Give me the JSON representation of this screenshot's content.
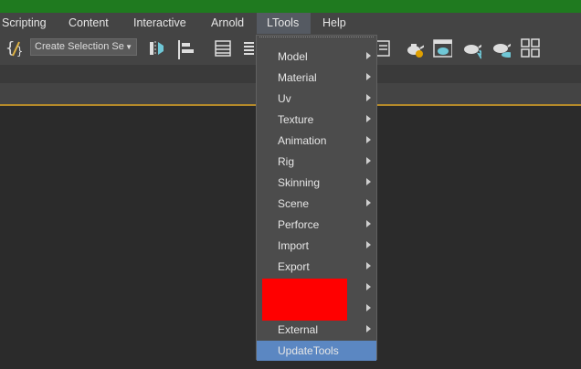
{
  "menubar": {
    "items": [
      "Scripting",
      "Content",
      "Interactive",
      "Arnold",
      "LTools",
      "Help"
    ]
  },
  "toolbar": {
    "selection_set_value": "Create Selection Se",
    "icons": [
      "script-brace-icon",
      "selection-set-combo",
      "mirror-icon",
      "align-icon",
      "layer-list-icon",
      "scene-explorer-icon",
      "render-setup-icon",
      "render-frame-icon",
      "render-teapot-icon",
      "render-active-icon",
      "render-cloud-icon",
      "viewport-layout-icon"
    ]
  },
  "dropdown": {
    "items": [
      {
        "label": "Model",
        "submenu": true
      },
      {
        "label": "Material",
        "submenu": true
      },
      {
        "label": "Uv",
        "submenu": true
      },
      {
        "label": "Texture",
        "submenu": true
      },
      {
        "label": "Animation",
        "submenu": true
      },
      {
        "label": "Rig",
        "submenu": true
      },
      {
        "label": "Skinning",
        "submenu": true
      },
      {
        "label": "Scene",
        "submenu": true
      },
      {
        "label": "Perforce",
        "submenu": true
      },
      {
        "label": "Import",
        "submenu": true
      },
      {
        "label": "Export",
        "submenu": true
      },
      {
        "label": "",
        "submenu": true
      },
      {
        "label": "",
        "submenu": true
      },
      {
        "label": "External",
        "submenu": true
      },
      {
        "label": "UpdateTools",
        "submenu": false
      }
    ],
    "highlighted": "UpdateTools",
    "redacted_color": "#ff0000"
  },
  "colors": {
    "title_bar": "#1f7a1f",
    "menu_bg": "#444444",
    "highlight": "#5b87c2",
    "viewport_accent": "#b58a2a"
  }
}
